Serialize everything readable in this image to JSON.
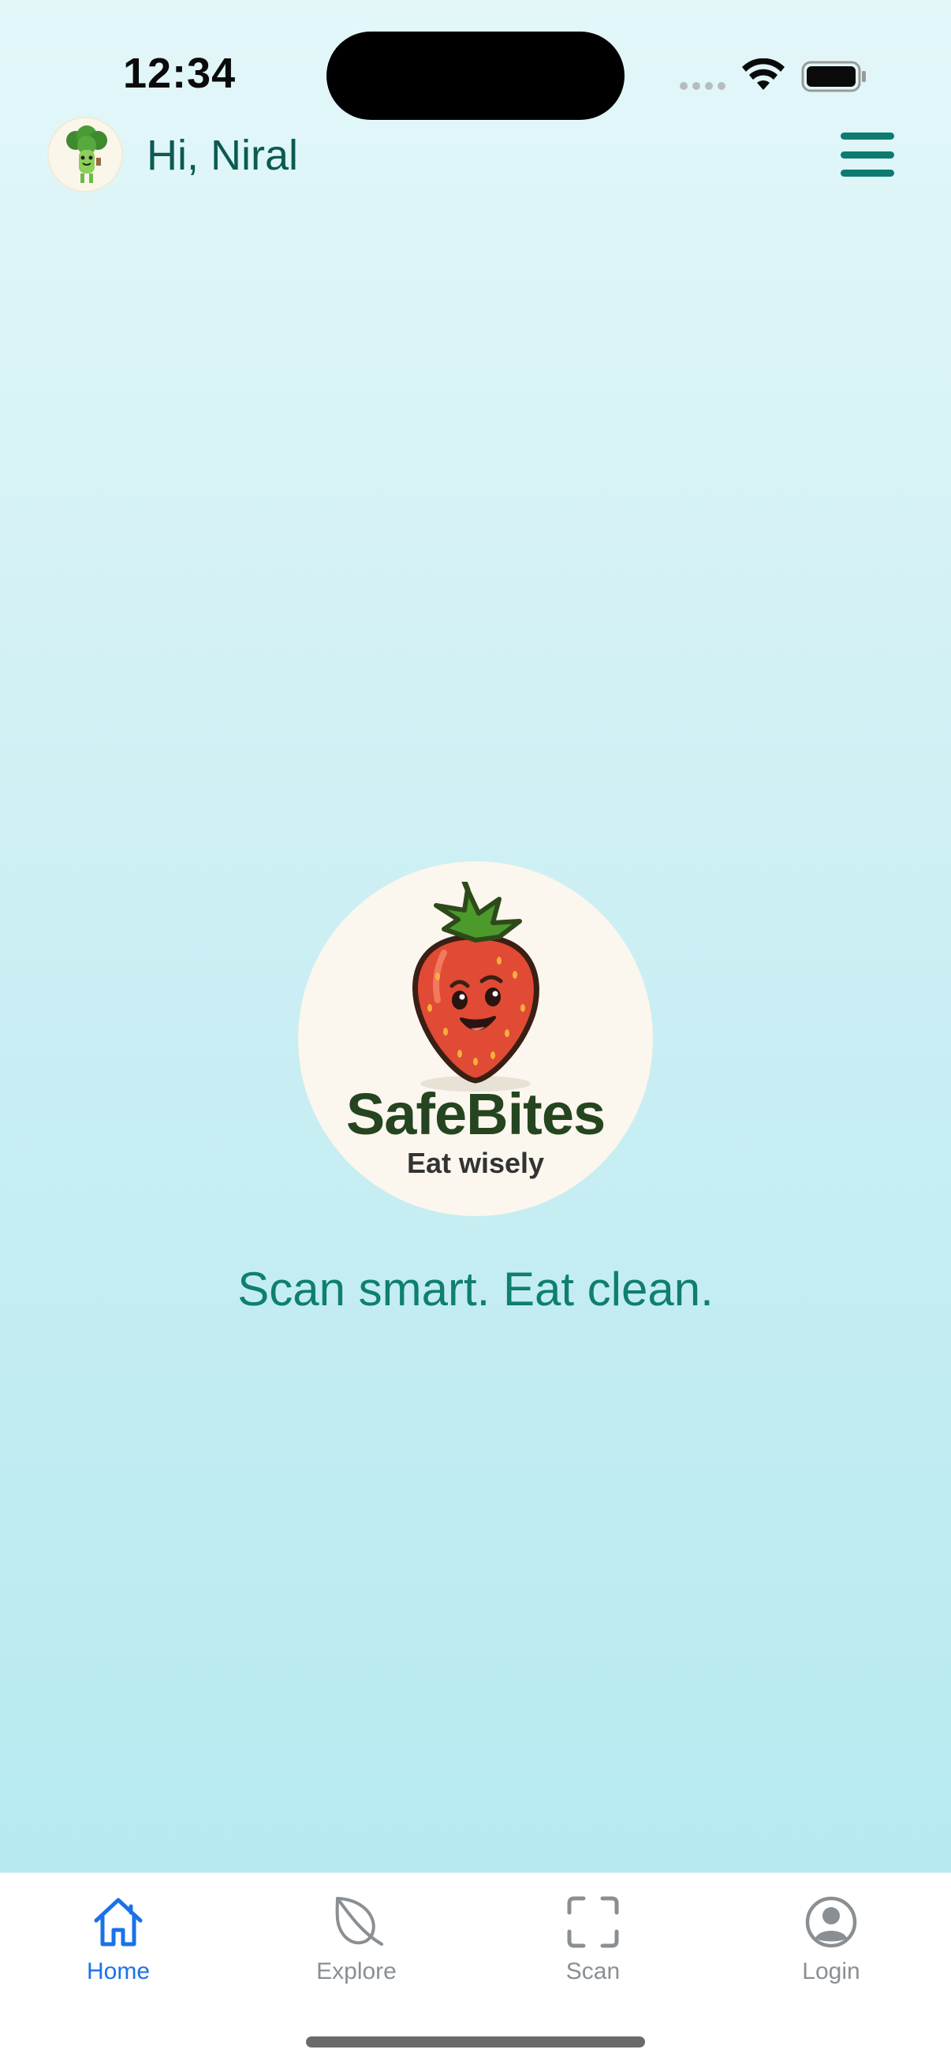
{
  "status_bar": {
    "time": "12:34",
    "icons": [
      "cellular-dots-icon",
      "wifi-icon",
      "battery-icon"
    ]
  },
  "header": {
    "greeting": "Hi, Niral",
    "avatar_icon": "broccoli-mascot-icon",
    "menu_icon": "hamburger-menu-icon"
  },
  "logo": {
    "name": "SafeBites",
    "tagline": "Eat wisely",
    "icon": "strawberry-mascot-icon"
  },
  "slogan": "Scan smart. Eat clean.",
  "tab_bar": {
    "tabs": [
      {
        "label": "Home",
        "icon": "home-icon",
        "active": true
      },
      {
        "label": "Explore",
        "icon": "leaf-icon",
        "active": false
      },
      {
        "label": "Scan",
        "icon": "scan-frame-icon",
        "active": false
      },
      {
        "label": "Login",
        "icon": "user-circle-icon",
        "active": false
      }
    ]
  },
  "colors": {
    "accent": "#0e7f71",
    "active_tab": "#1b72e8",
    "inactive_tab": "#8a8f93",
    "logo_text": "#24451f"
  }
}
